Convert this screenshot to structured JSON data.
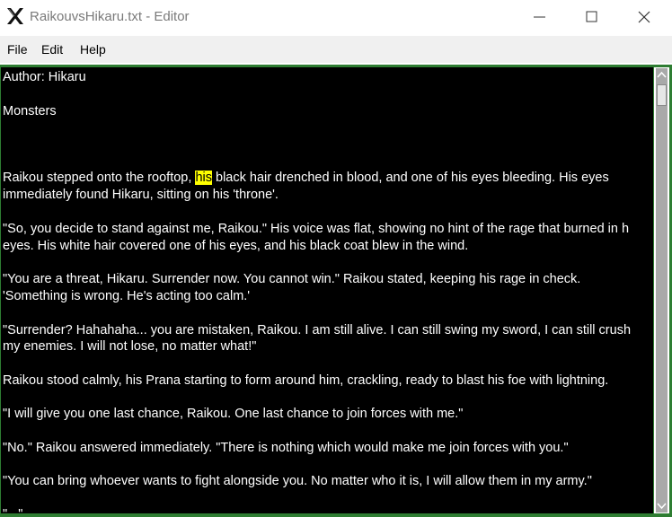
{
  "window": {
    "title": "RaikouvsHikaru.txt - Editor",
    "app_icon": "x-app-icon",
    "controls": [
      "minimize-icon",
      "maximize-icon",
      "close-icon"
    ]
  },
  "menu": {
    "file": "File",
    "edit": "Edit",
    "help": "Help"
  },
  "document": {
    "lines": [
      "Author: Hikaru",
      "",
      "Monsters",
      "",
      "",
      "",
      "",
      "immediately found Hikaru, sitting on his 'throne'.",
      "",
      "\"So, you decide to stand against me, Raikou.\" His voice was flat, showing no hint of the rage that burned in h",
      "eyes. His white hair covered one of his eyes, and his black coat blew in the wind.",
      "",
      "\"You are a threat, Hikaru. Surrender now. You cannot win.\" Raikou stated, keeping his rage in check.",
      "'Something is wrong. He's acting too calm.'",
      "",
      "\"Surrender? Hahahaha... you are mistaken, Raikou. I am still alive. I can still swing my sword, I can still crush",
      "my enemies. I will not lose, no matter what!\"",
      "",
      "Raikou stood calmly, his Prana starting to form around him, crackling, ready to blast his foe with lightning.",
      "",
      "\"I will give you one last chance, Raikou. One last chance to join forces with me.\"",
      "",
      "\"No.\" Raikou answered immediately. \"There is nothing which would make me join forces with you.\"",
      "",
      "\"You can bring whoever wants to fight alongside you. No matter who it is, I will allow them in my army.\"",
      "",
      "\"...\""
    ],
    "highlight_line": {
      "before": "Raikou stepped onto the rooftop, ",
      "match": "his",
      "after": " black hair drenched in blood, and one of his eyes bleeding. His eyes"
    }
  },
  "colors": {
    "editor_bg": "#000000",
    "editor_text": "#ffffff",
    "highlight": "#ffff00",
    "frame": "#2e7d32"
  }
}
